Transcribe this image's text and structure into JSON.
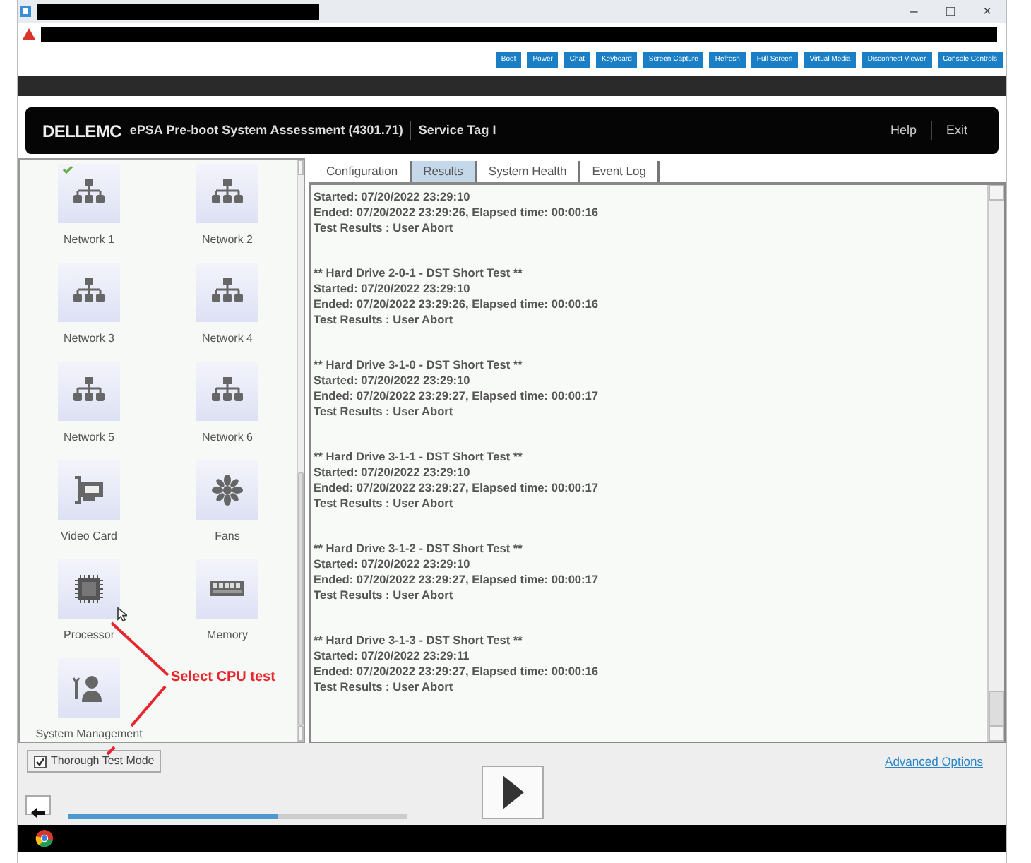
{
  "window": {
    "controls": [
      "–",
      "□",
      "×"
    ]
  },
  "toolbar": [
    "Boot",
    "Power",
    "Chat",
    "Keyboard",
    "Screen Capture",
    "Refresh",
    "Full Screen",
    "Virtual Media",
    "Disconnect Viewer",
    "Console Controls"
  ],
  "header": {
    "logo": "DELLEMC",
    "title": "ePSA Pre-boot System Assessment (4301.71)",
    "service_tag_label": "Service Tag I",
    "links": [
      "Help",
      "Exit"
    ]
  },
  "devices": [
    {
      "label": "Network 1",
      "kind": "network",
      "checked": true
    },
    {
      "label": "Network 2",
      "kind": "network",
      "checked": false
    },
    {
      "label": "Network 3",
      "kind": "network",
      "checked": false
    },
    {
      "label": "Network 4",
      "kind": "network",
      "checked": false
    },
    {
      "label": "Network 5",
      "kind": "network",
      "checked": false
    },
    {
      "label": "Network 6",
      "kind": "network",
      "checked": false
    },
    {
      "label": "Video Card",
      "kind": "card",
      "checked": false
    },
    {
      "label": "Fans",
      "kind": "fan",
      "checked": false
    },
    {
      "label": "Processor",
      "kind": "chip",
      "checked": false
    },
    {
      "label": "Memory",
      "kind": "memory",
      "checked": false
    },
    {
      "label": "System Management",
      "kind": "person",
      "checked": false
    }
  ],
  "tabs": [
    {
      "label": "Configuration",
      "selected": false
    },
    {
      "label": "Results",
      "selected": true
    },
    {
      "label": "System Health",
      "selected": false
    },
    {
      "label": "Event Log",
      "selected": false
    }
  ],
  "log": [
    {
      "lines": [
        "Started: 07/20/2022 23:29:10",
        "Ended: 07/20/2022 23:29:26, Elapsed time: 00:00:16",
        "Test Results : User Abort"
      ]
    },
    {
      "heading": "** Hard Drive 2-0-1 - DST Short Test **",
      "lines": [
        "Started: 07/20/2022 23:29:10",
        "Ended: 07/20/2022 23:29:26, Elapsed time: 00:00:16",
        "Test Results : User Abort"
      ]
    },
    {
      "heading": "** Hard Drive 3-1-0 - DST Short Test **",
      "lines": [
        "Started: 07/20/2022 23:29:10",
        "Ended: 07/20/2022 23:29:27, Elapsed time: 00:00:17",
        "Test Results : User Abort"
      ]
    },
    {
      "heading": "** Hard Drive 3-1-1 - DST Short Test **",
      "lines": [
        "Started: 07/20/2022 23:29:10",
        "Ended: 07/20/2022 23:29:27, Elapsed time: 00:00:17",
        "Test Results : User Abort"
      ]
    },
    {
      "heading": "** Hard Drive 3-1-2 - DST Short Test **",
      "lines": [
        "Started: 07/20/2022 23:29:10",
        "Ended: 07/20/2022 23:29:27, Elapsed time: 00:00:17",
        "Test Results : User Abort"
      ]
    },
    {
      "heading": "** Hard Drive 3-1-3 - DST Short Test **",
      "lines": [
        "Started: 07/20/2022 23:29:11",
        "Ended: 07/20/2022 23:29:27, Elapsed time: 00:00:16",
        "Test Results : User Abort"
      ]
    }
  ],
  "thorough_mode": {
    "label": "Thorough Test Mode",
    "checked": true
  },
  "advanced_link": "Advanced Options",
  "progress": {
    "level": 0.62
  },
  "annotation": "Select CPU test"
}
